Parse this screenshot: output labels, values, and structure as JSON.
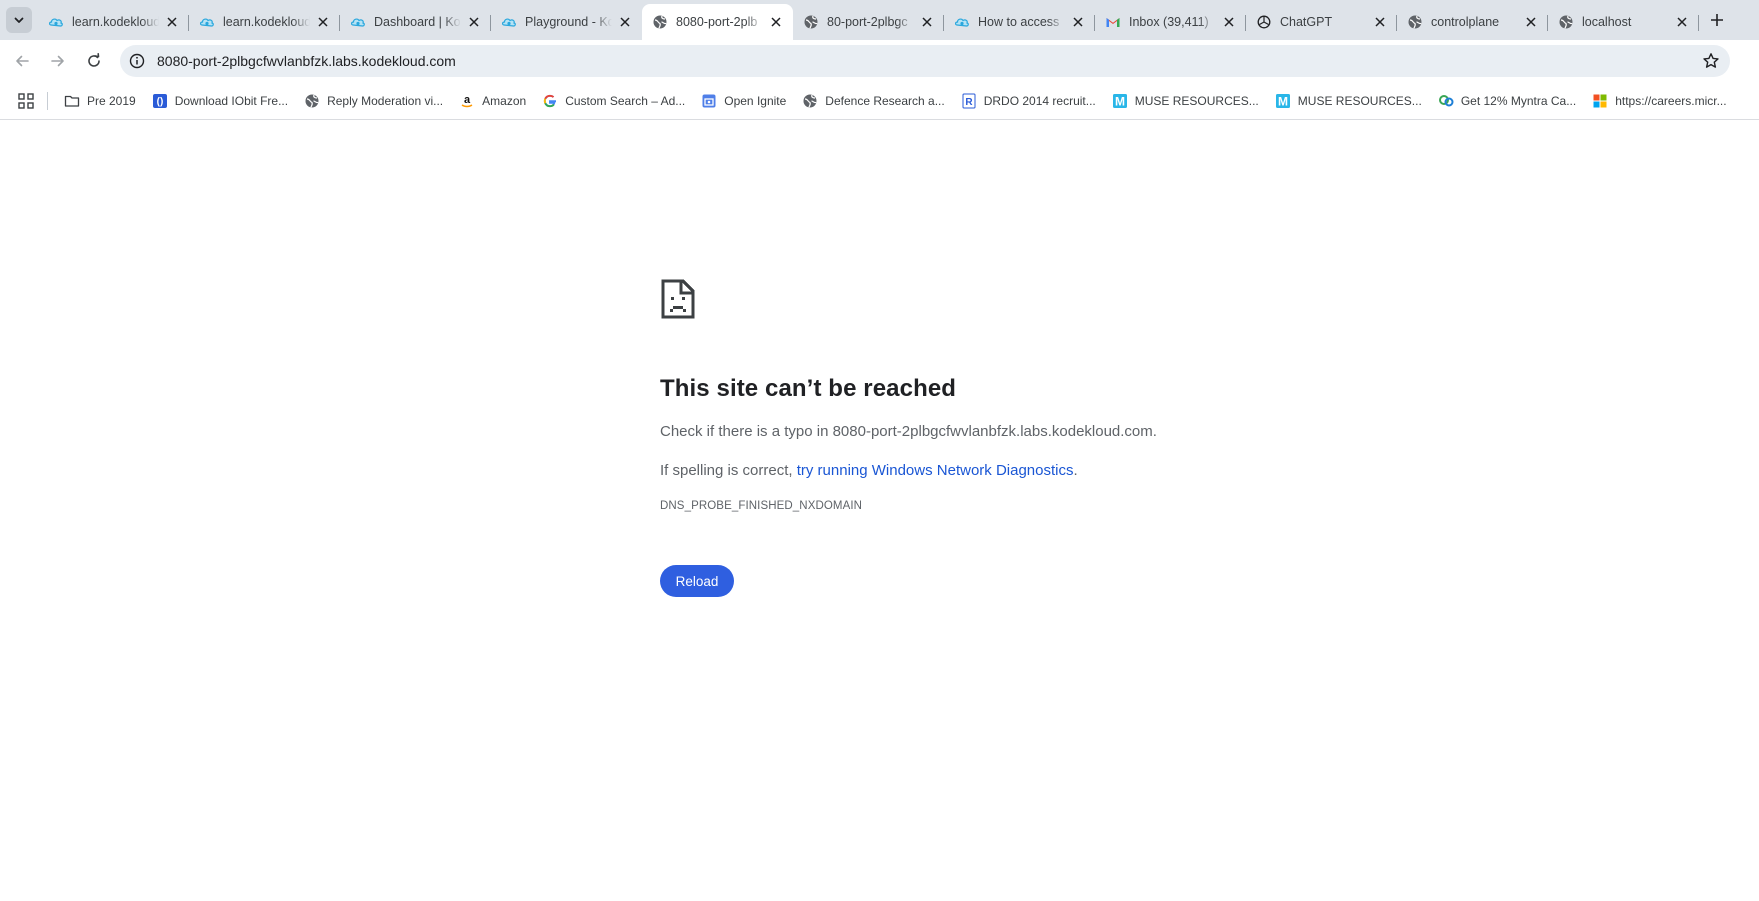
{
  "tabs": [
    {
      "title": "learn.kodekloud",
      "icon": "kodekloud-icon",
      "active": false
    },
    {
      "title": "learn.kodekloud",
      "icon": "kodekloud-icon",
      "active": false
    },
    {
      "title": "Dashboard | Ko",
      "icon": "kodekloud-icon",
      "active": false
    },
    {
      "title": "Playground - Ko",
      "icon": "kodekloud-icon",
      "active": false
    },
    {
      "title": "8080-port-2plb",
      "icon": "globe-icon",
      "active": true
    },
    {
      "title": "80-port-2plbgc",
      "icon": "globe-icon",
      "active": false
    },
    {
      "title": "How to access",
      "icon": "kodekloud-icon",
      "active": false
    },
    {
      "title": "Inbox (39,411)",
      "icon": "gmail-icon",
      "active": false
    },
    {
      "title": "ChatGPT",
      "icon": "chatgpt-icon",
      "active": false
    },
    {
      "title": "controlplane",
      "icon": "globe-icon",
      "active": false
    },
    {
      "title": "localhost",
      "icon": "globe-icon",
      "active": false
    }
  ],
  "toolbar": {
    "url": "8080-port-2plbgcfwvlanbfzk.labs.kodekloud.com"
  },
  "bookmarks": [
    {
      "label": "Pre 2019",
      "icon": "folder-icon"
    },
    {
      "label": "Download IObit Fre...",
      "icon": "iobit-icon"
    },
    {
      "label": "Reply Moderation vi...",
      "icon": "globe-icon"
    },
    {
      "label": "Amazon",
      "icon": "amazon-icon"
    },
    {
      "label": "Custom Search – Ad...",
      "icon": "google-icon"
    },
    {
      "label": "Open Ignite",
      "icon": "ignite-icon"
    },
    {
      "label": "Defence Research a...",
      "icon": "globe-icon"
    },
    {
      "label": "DRDO 2014 recruit...",
      "icon": "drdo-icon"
    },
    {
      "label": "MUSE RESOURCES...",
      "icon": "muse-icon"
    },
    {
      "label": "MUSE RESOURCES...",
      "icon": "muse-icon"
    },
    {
      "label": "Get 12% Myntra Ca...",
      "icon": "cashback-icon"
    },
    {
      "label": "https://careers.micr...",
      "icon": "microsoft-icon"
    }
  ],
  "error": {
    "title": "This site can’t be reached",
    "typo_prefix": "Check if there is a typo in ",
    "typo_host": "8080-port-2plbgcfwvlanbfzk.labs.kodekloud.com",
    "typo_suffix": ".",
    "spelling_prefix": "If spelling is correct, ",
    "diagnostics_link": "try running Windows Network Diagnostics",
    "spelling_suffix": ".",
    "code": "DNS_PROBE_FINISHED_NXDOMAIN",
    "reload_label": "Reload"
  },
  "colors": {
    "tabstrip_bg": "#dee3e9",
    "link": "#1a56d4",
    "reload_button": "#2f5fe0"
  }
}
